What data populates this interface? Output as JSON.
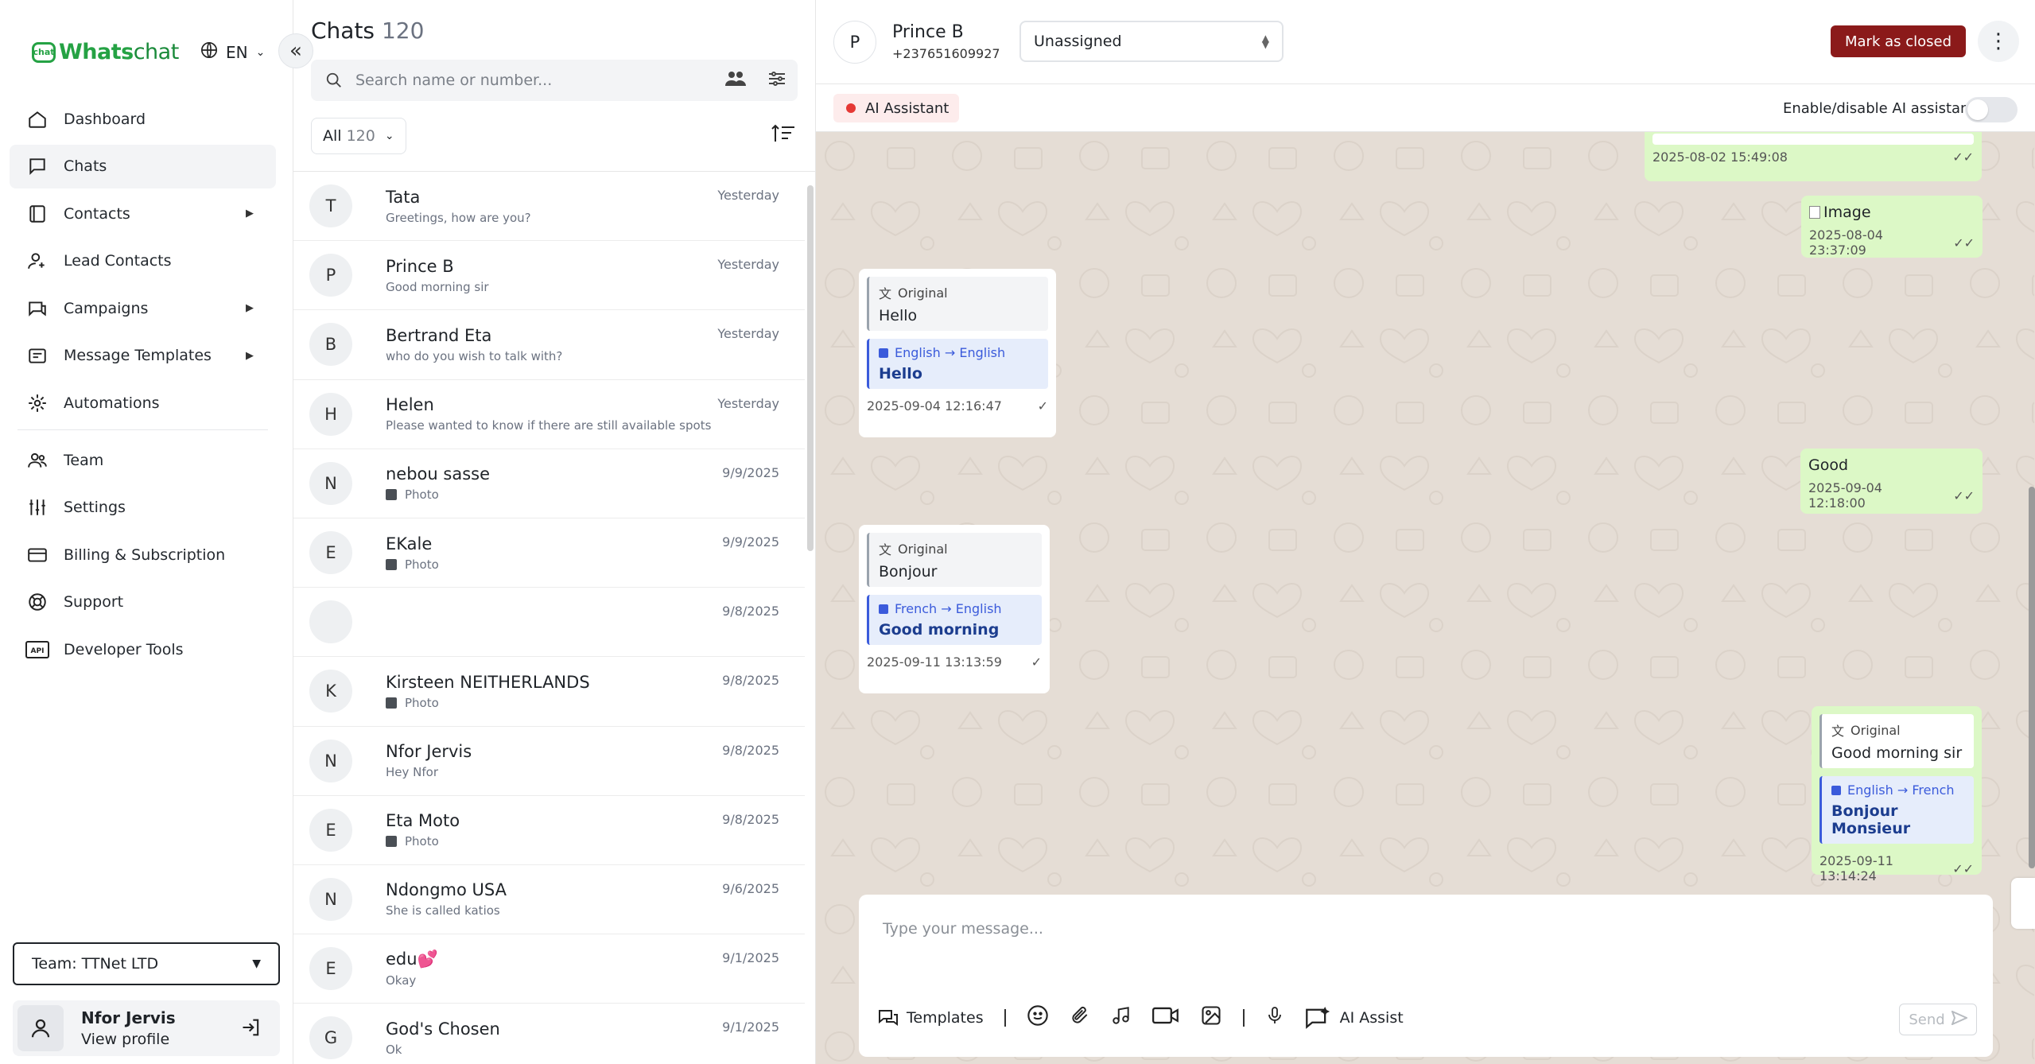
{
  "brand": {
    "logo_badge": "chat",
    "logo_primary": "Whats",
    "logo_secondary": "chat",
    "color": "#25a244"
  },
  "lang": {
    "label": "EN"
  },
  "nav": {
    "items": [
      {
        "label": "Dashboard",
        "icon": "home-icon"
      },
      {
        "label": "Chats",
        "icon": "chat-icon",
        "active": true
      },
      {
        "label": "Contacts",
        "icon": "contacts-icon",
        "submenu": true
      },
      {
        "label": "Lead Contacts",
        "icon": "user-plus-icon"
      },
      {
        "label": "Campaigns",
        "icon": "campaign-icon",
        "submenu": true
      },
      {
        "label": "Message Templates",
        "icon": "template-icon",
        "submenu": true
      },
      {
        "label": "Automations",
        "icon": "automation-icon"
      },
      {
        "label": "Team",
        "icon": "team-icon"
      },
      {
        "label": "Settings",
        "icon": "sliders-icon"
      },
      {
        "label": "Billing & Subscription",
        "icon": "card-icon"
      },
      {
        "label": "Support",
        "icon": "lifebuoy-icon"
      },
      {
        "label": "Developer Tools",
        "icon": "api-icon"
      }
    ],
    "team_select": "Team: TTNet LTD",
    "profile": {
      "name": "Nfor Jervis",
      "link": "View profile"
    }
  },
  "chat_list": {
    "title": "Chats",
    "count": "120",
    "search_placeholder": "Search name or number...",
    "filter_label": "All",
    "filter_count": "120",
    "chats": [
      {
        "initial": "T",
        "name": "Tata",
        "preview": "Greetings, how are you?",
        "time": "Yesterday",
        "photo": false
      },
      {
        "initial": "P",
        "name": "Prince B",
        "preview": "Good morning sir",
        "time": "Yesterday",
        "photo": false
      },
      {
        "initial": "B",
        "name": "Bertrand Eta",
        "preview": "who do you wish to talk with?",
        "time": "Yesterday",
        "photo": false
      },
      {
        "initial": "H",
        "name": "Helen",
        "preview": "Please wanted to know if there are still available spots",
        "time": "Yesterday",
        "photo": false
      },
      {
        "initial": "N",
        "name": "nebou sasse",
        "preview": "Photo",
        "time": "9/9/2025",
        "photo": true
      },
      {
        "initial": "E",
        "name": "EKale",
        "preview": "Photo",
        "time": "9/9/2025",
        "photo": true
      },
      {
        "initial": "",
        "name": "",
        "preview": "",
        "time": "9/8/2025",
        "photo": false
      },
      {
        "initial": "K",
        "name": "Kirsteen NEITHERLANDS",
        "preview": "Photo",
        "time": "9/8/2025",
        "photo": true
      },
      {
        "initial": "N",
        "name": "Nfor Jervis",
        "preview": "Hey Nfor",
        "time": "9/8/2025",
        "photo": false
      },
      {
        "initial": "E",
        "name": "Eta Moto",
        "preview": "Photo",
        "time": "9/8/2025",
        "photo": true
      },
      {
        "initial": "N",
        "name": "Ndongmo USA",
        "preview": "She is called katios",
        "time": "9/6/2025",
        "photo": false
      },
      {
        "initial": "E",
        "name": "edu💕",
        "preview": "Okay",
        "time": "9/1/2025",
        "photo": false
      },
      {
        "initial": "G",
        "name": "God's Chosen",
        "preview": "Ok",
        "time": "9/1/2025",
        "photo": false
      }
    ]
  },
  "conversation": {
    "avatar_initial": "P",
    "name": "Prince B",
    "phone": "+237651609927",
    "assignee": "Unassigned",
    "mark_closed": "Mark as closed",
    "ai_chip": "AI Assistant",
    "ai_toggle_label": "Enable/disable AI assistant",
    "messages": {
      "m1_time": "2025-08-02 15:49:08",
      "m2_alt": "Image",
      "m2_time": "2025-08-04 23:37:09",
      "m3_original_label": "Original",
      "m3_original": "Hello",
      "m3_lang": "English → English",
      "m3_translated": "Hello",
      "m3_time": "2025-09-04 12:16:47",
      "m4_text": "Good",
      "m4_time": "2025-09-04 12:18:00",
      "m5_original_label": "Original",
      "m5_original": "Bonjour",
      "m5_lang": "French → English",
      "m5_translated": "Good morning",
      "m5_time": "2025-09-11 13:13:59",
      "m6_original_label": "Original",
      "m6_original": "Good morning sir",
      "m6_lang": "English → French",
      "m6_translated": "Bonjour Monsieur",
      "m6_time": "2025-09-11 13:14:24"
    },
    "composer": {
      "placeholder": "Type your message...",
      "templates": "Templates",
      "ai_assist": "AI Assist",
      "send": "Send"
    }
  },
  "colors": {
    "accent_closed": "#8b1a1a",
    "chat_bg": "#e5ddd5",
    "out_bubble": "#dcf8c6"
  }
}
